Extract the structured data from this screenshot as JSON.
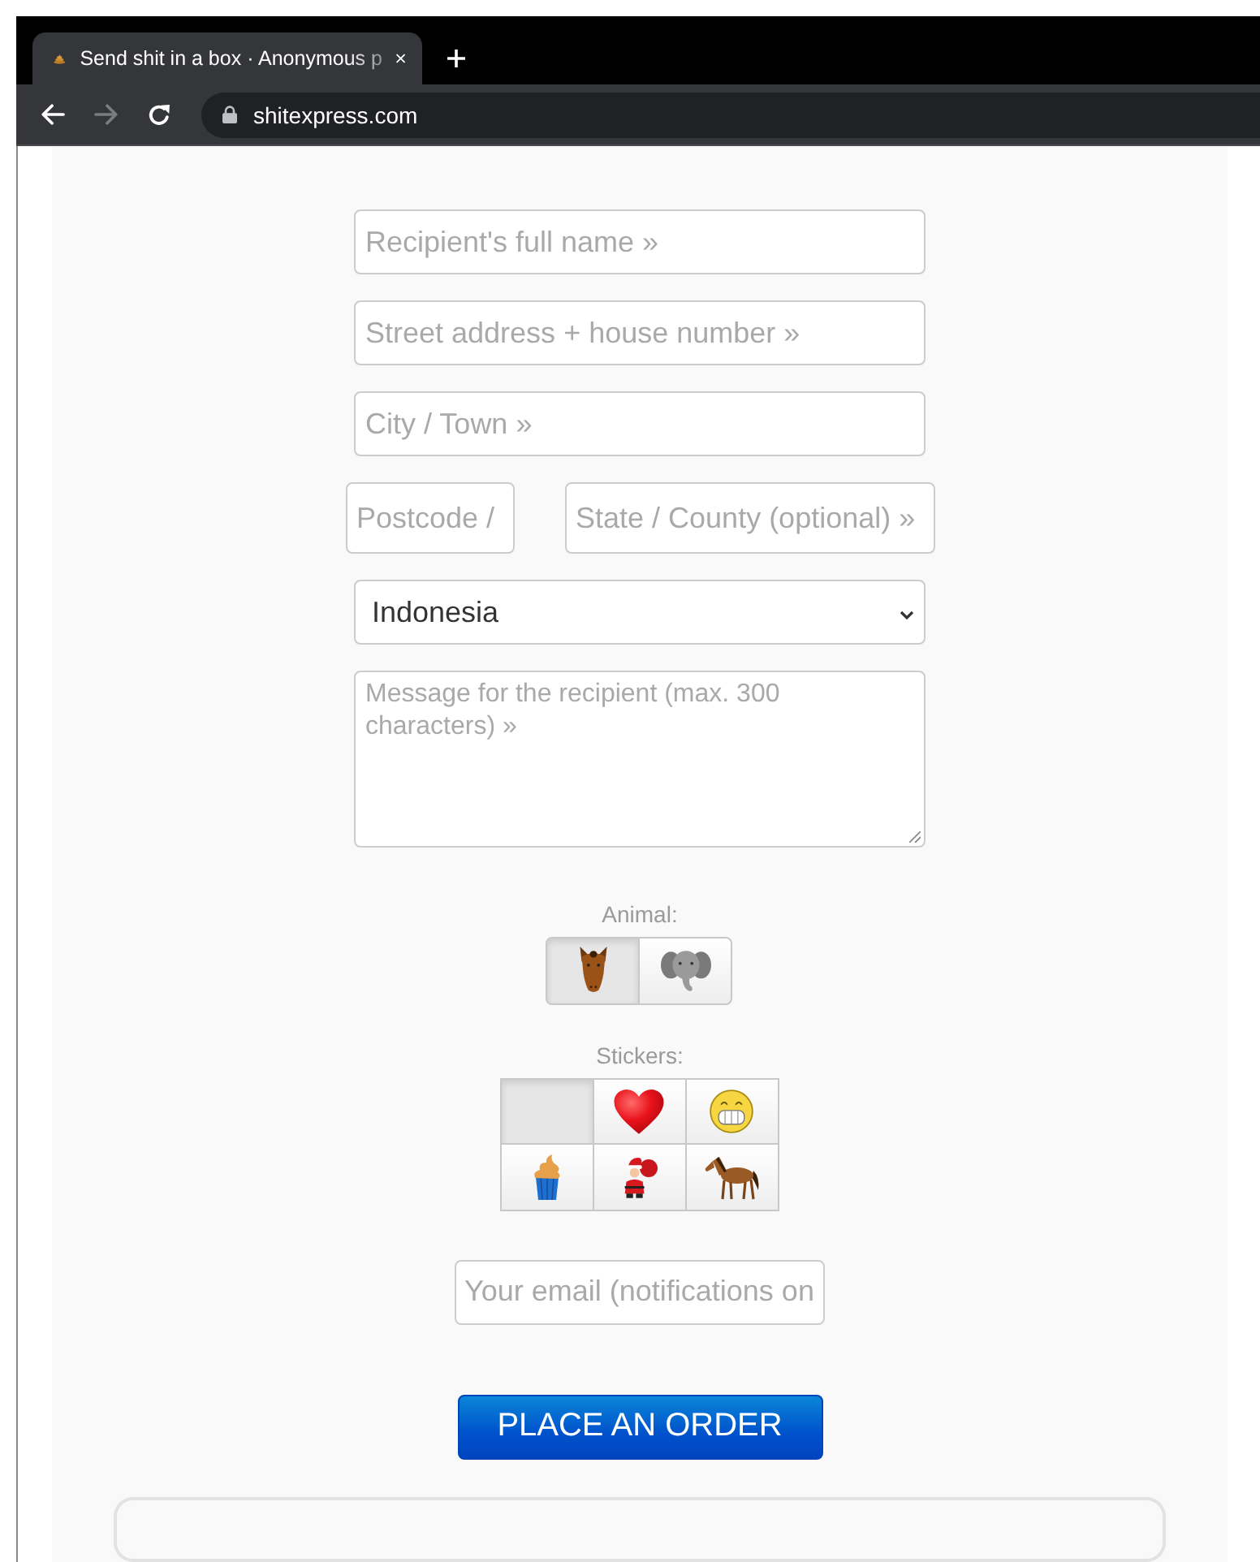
{
  "browser": {
    "tabs": [
      {
        "title": "Send shit in a box · Anonymous p",
        "selected": true
      }
    ],
    "nav": [
      {
        "kind": "back",
        "disabled": false
      },
      {
        "kind": "forward",
        "disabled": true
      },
      {
        "kind": "reload",
        "disabled": false
      }
    ],
    "address": "shitexpress.com"
  },
  "form": {
    "recipient_name": {
      "placeholder": "Recipient's full name »"
    },
    "street_address": {
      "placeholder": "Street address + house number »"
    },
    "city": {
      "placeholder": "City / Town »"
    },
    "postcode": {
      "placeholder": "Postcode /"
    },
    "state": {
      "placeholder": "State / County (optional) »"
    },
    "country": {
      "value": "Indonesia"
    },
    "message": {
      "placeholder": "Message for the recipient (max. 300 characters) »"
    },
    "animal": {
      "label": "Animal:",
      "options": [
        {
          "kind": "horse_head",
          "selected": true
        },
        {
          "kind": "elephant",
          "selected": false
        }
      ]
    },
    "stickers": {
      "label": "Stickers:",
      "options": [
        {
          "kind": "none",
          "selected": true
        },
        {
          "kind": "heart",
          "selected": false
        },
        {
          "kind": "grin",
          "selected": false
        },
        {
          "kind": "cupcake",
          "selected": false
        },
        {
          "kind": "santa",
          "selected": false
        },
        {
          "kind": "horse",
          "selected": false
        }
      ]
    },
    "email": {
      "placeholder": "Your email (notifications on"
    },
    "order_button": {
      "label": "PLACE AN ORDER"
    }
  }
}
